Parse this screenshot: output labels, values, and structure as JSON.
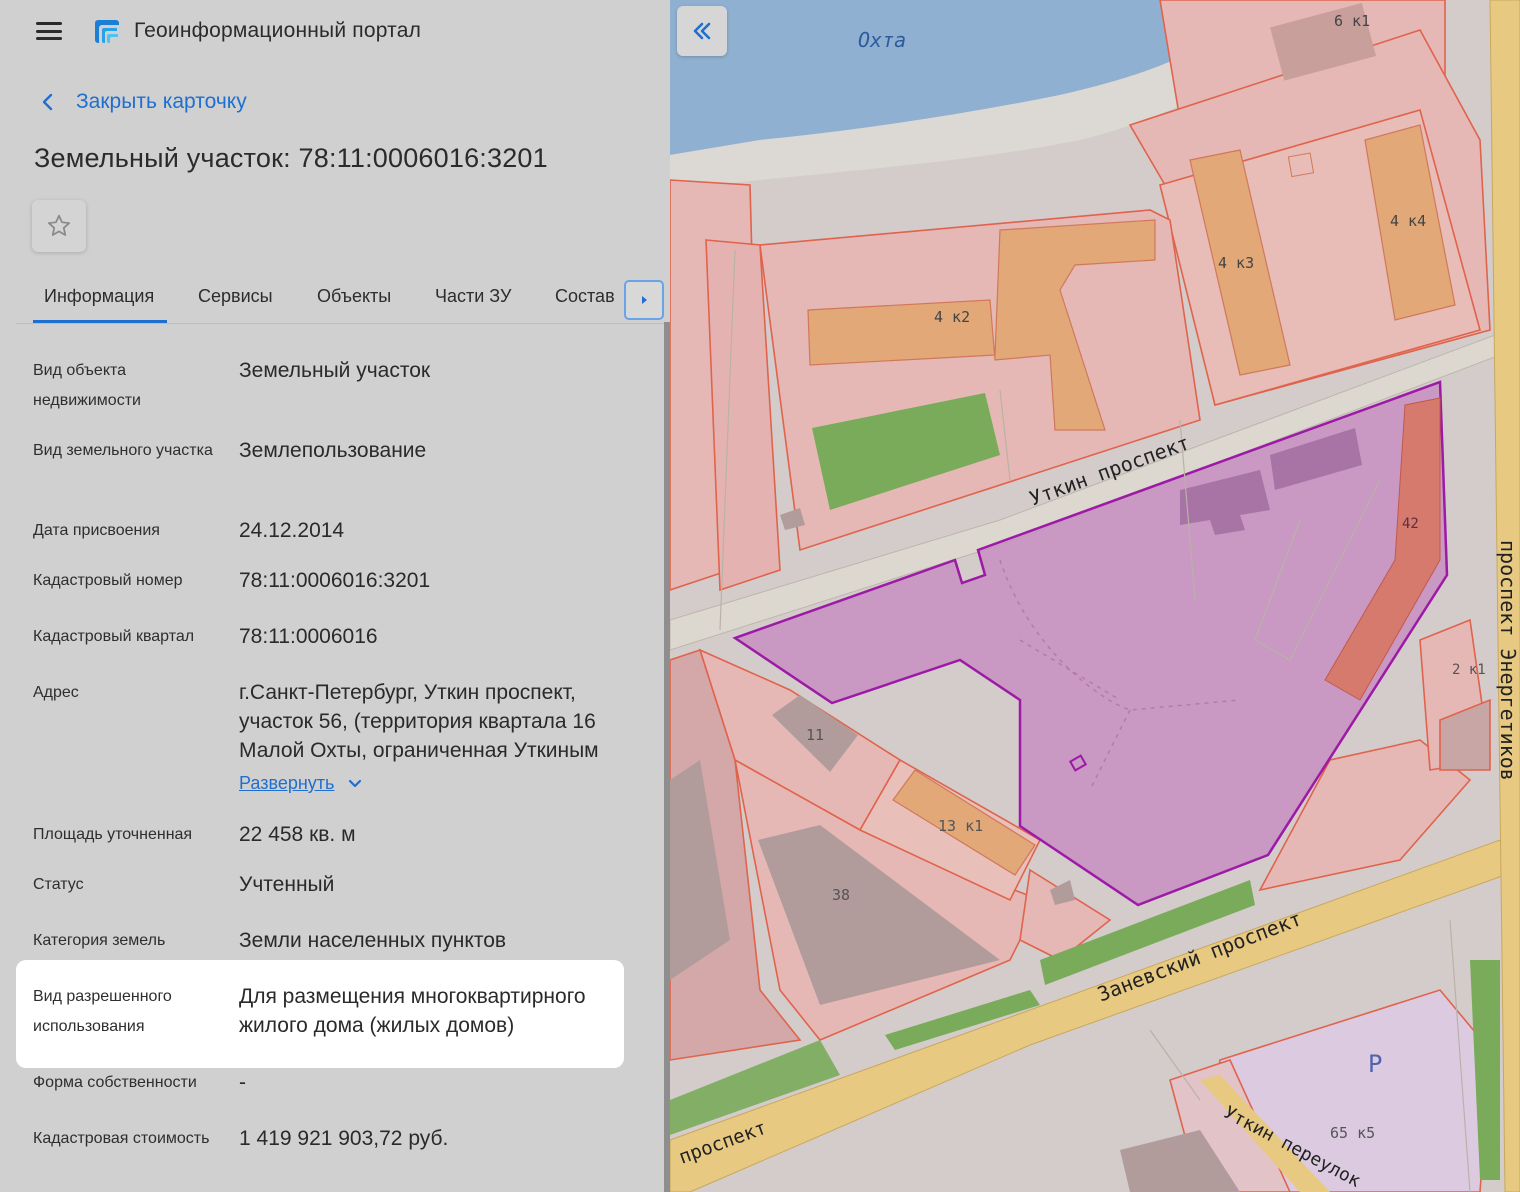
{
  "header": {
    "app_title": "Геоинформационный портал",
    "menu_icon": "hamburger-menu-icon",
    "logo_icon": "portal-logo-icon"
  },
  "card": {
    "close_label": "Закрыть карточку",
    "title": "Земельный участок: 78:11:0006016:3201",
    "favorite_icon": "star-icon"
  },
  "tabs": [
    {
      "label": "Информация",
      "active": true
    },
    {
      "label": "Сервисы"
    },
    {
      "label": "Объекты"
    },
    {
      "label": "Части ЗУ"
    },
    {
      "label": "Состав"
    }
  ],
  "properties": [
    {
      "label": "Вид объекта недвижимости",
      "value": "Земельный участок"
    },
    {
      "label": "Вид земельного участка",
      "value": "Землепользование"
    },
    {
      "label": "Дата присвоения",
      "value": "24.12.2014"
    },
    {
      "label": "Кадастровый номер",
      "value": "78:11:0006016:3201"
    },
    {
      "label": "Кадастровый квартал",
      "value": "78:11:0006016"
    },
    {
      "label": "Адрес",
      "value": "г.Санкт-Петербург, Уткин проспект, участок 56, (территория квартала 16 Малой Охты, ограниченная Уткиным"
    },
    {
      "label": "Площадь уточненная",
      "value": "22 458 кв. м"
    },
    {
      "label": "Статус",
      "value": "Учтенный"
    },
    {
      "label": "Категория земель",
      "value": "Земли населенных пунктов"
    },
    {
      "label": "Вид разрешенного использования",
      "value": "Для размещения многоквартирного жилого дома (жилых домов)",
      "highlighted": true
    },
    {
      "label": "Форма собственности",
      "value": "-"
    },
    {
      "label": "Кадастровая стоимость",
      "value": "1 419 921 903,72 руб."
    }
  ],
  "expand_label": "Развернуть",
  "map": {
    "labels": {
      "river": "Охта",
      "b_6k1": "6 к1",
      "b_4k4": "4 к4",
      "b_4k3": "4 к3",
      "b_4k2": "4 к2",
      "street_utkin": "Уткин проспект",
      "b_42": "42",
      "street_energetikov": "проспект Энергетиков",
      "b_2k1": "2 к1",
      "b_11": "11",
      "b_13k1": "13 к1",
      "b_38": "38",
      "street_zanevsky": "Заневский проспект",
      "parking": "P",
      "b_65k5": "65 к5",
      "street_utkin_per": "Уткин переулок",
      "street_prospekt": "проспект"
    },
    "colors": {
      "water": "#8fb0d1",
      "parcel_fill": "#e8b9b6",
      "parcel_stroke": "#e06a52",
      "building": "#e2ab7c",
      "green": "#7aab5a",
      "selected_fill": "#c98fc3",
      "selected_stroke": "#9c1aa6",
      "road": "#ddd8cf",
      "major_road": "#e9c97f"
    }
  }
}
